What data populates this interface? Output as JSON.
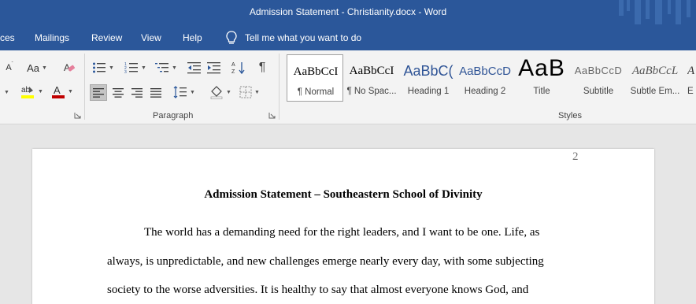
{
  "window": {
    "title": "Admission Statement - Christianity.docx  -  Word"
  },
  "tabs": [
    {
      "label": "ces"
    },
    {
      "label": "Mailings"
    },
    {
      "label": "Review"
    },
    {
      "label": "View"
    },
    {
      "label": "Help"
    }
  ],
  "tell_me": {
    "label": "Tell me what you want to do"
  },
  "ribbon": {
    "font_group": {
      "change_case_label": "Aa",
      "shrink_label": "A",
      "highlight_color": "#ffff00",
      "font_color": "#c00000"
    },
    "paragraph_group": {
      "label": "Paragraph",
      "alignment_active": "left"
    },
    "styles_group": {
      "label": "Styles",
      "items": [
        {
          "sample": "AaBbCcI",
          "name": "¶ Normal"
        },
        {
          "sample": "AaBbCcI",
          "name": "¶ No Spac..."
        },
        {
          "sample": "AaBbC(",
          "name": "Heading 1"
        },
        {
          "sample": "AaBbCcD",
          "name": "Heading 2"
        },
        {
          "sample": "AaB",
          "name": "Title"
        },
        {
          "sample": "AaBbCcD",
          "name": "Subtitle"
        },
        {
          "sample": "AaBbCcL",
          "name": "Subtle Em..."
        },
        {
          "sample": "A",
          "name": "E"
        }
      ]
    }
  },
  "document": {
    "page_number": "2",
    "title": "Admission Statement – Southeastern School of Divinity",
    "paragraph_lines": [
      "The world has a demanding need for the right leaders, and I want to be one. Life, as",
      "always, is unpredictable, and new challenges emerge nearly every day, with some subjecting",
      "society to the worse adversities. It is healthy to say that almost everyone knows God, and"
    ]
  },
  "colors": {
    "title_bar": "#2b579a",
    "ribbon_bg": "#f3f3f3",
    "doc_bg": "#e6e6e6",
    "heading_blue": "#2f5496"
  }
}
